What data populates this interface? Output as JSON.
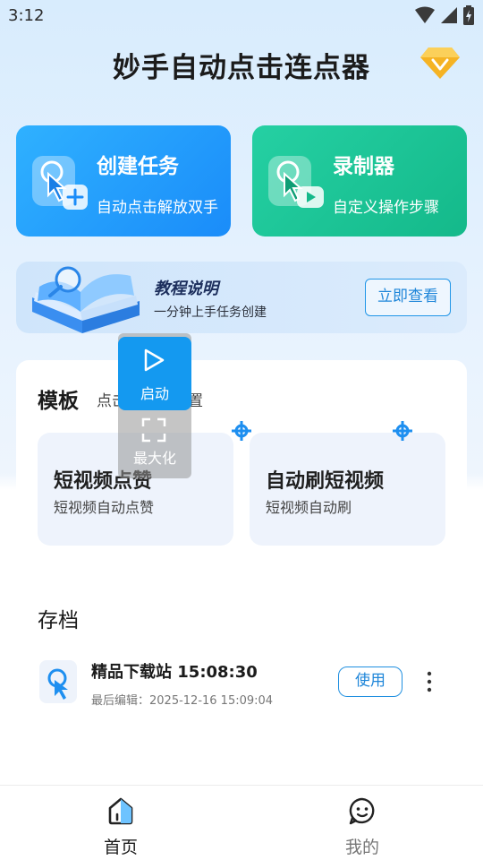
{
  "status_bar": {
    "time": "3:12"
  },
  "header": {
    "title": "妙手自动点击连点器",
    "vip_icon": "diamond-icon"
  },
  "feature_cards": {
    "create": {
      "title": "创建任务",
      "subtitle": "自动点击解放双手",
      "icon": "tap-plus-icon",
      "color": "#1e95fb"
    },
    "record": {
      "title": "录制器",
      "subtitle": "自定义操作步骤",
      "icon": "tap-video-icon",
      "color": "#1dc49a"
    }
  },
  "tutorial": {
    "title": "教程说明",
    "subtitle": "一分钟上手任务创建",
    "button": "立即查看"
  },
  "templates": {
    "title": "模板",
    "hint": "点击可修改配置",
    "items": [
      {
        "title": "短视频点赞",
        "subtitle": "短视频自动点赞"
      },
      {
        "title": "自动刷短视频",
        "subtitle": "短视频自动刷"
      }
    ]
  },
  "floating_widget": {
    "start_label": "启动",
    "maximize_label": "最大化"
  },
  "archive": {
    "title": "存档",
    "items": [
      {
        "name": "精品下载站 15:08:30",
        "meta": "最后编辑：2025-12-16 15:09:04",
        "action": "使用"
      }
    ]
  },
  "bottom_nav": {
    "items": [
      {
        "label": "首页",
        "active": true
      },
      {
        "label": "我的",
        "active": false
      }
    ]
  }
}
